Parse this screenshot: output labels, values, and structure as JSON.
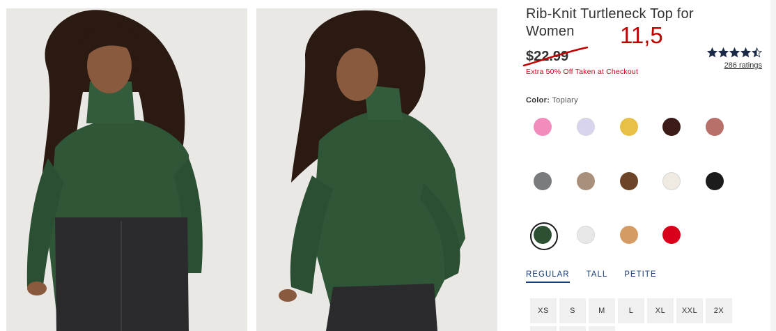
{
  "product": {
    "title": "Rib-Knit Turtleneck Top for Women",
    "annotation": "11,5",
    "price_original": "$22.99",
    "promo": "Extra 50% Off Taken at Checkout",
    "rating": {
      "value": 4.5,
      "max": 5,
      "count_label": "286 ratings"
    }
  },
  "color": {
    "label": "Color:",
    "selected": "Topiary",
    "swatches": [
      {
        "color": "#f28cbc",
        "selected": false
      },
      {
        "color": "#d8d3ee",
        "selected": false
      },
      {
        "color": "#e8c048",
        "selected": false
      },
      {
        "color": "#3c1c18",
        "selected": false
      },
      {
        "color": "#b8706a",
        "selected": false
      },
      {
        "color": "#7a7b7e",
        "selected": false
      },
      {
        "color": "#a8907c",
        "selected": false
      },
      {
        "color": "#6e4428",
        "selected": false
      },
      {
        "color": "#efebe3",
        "selected": false
      },
      {
        "color": "#1c1c1c",
        "selected": false
      },
      {
        "color": "#2d5033",
        "selected": true
      },
      {
        "color": "#e8e8e8",
        "selected": false
      },
      {
        "color": "#d49c64",
        "selected": false
      },
      {
        "color": "#d9001b",
        "selected": false
      }
    ]
  },
  "fit_tabs": [
    {
      "label": "REGULAR",
      "active": true
    },
    {
      "label": "TALL",
      "active": false
    },
    {
      "label": "PETITE",
      "active": false
    }
  ],
  "sizes": [
    "XS",
    "S",
    "M",
    "L",
    "XL",
    "XXL",
    "2X"
  ],
  "colors": {
    "accent": "#1a3d78",
    "promo": "#d0021b",
    "annotation": "#c00000",
    "star": "#1b2a47"
  }
}
